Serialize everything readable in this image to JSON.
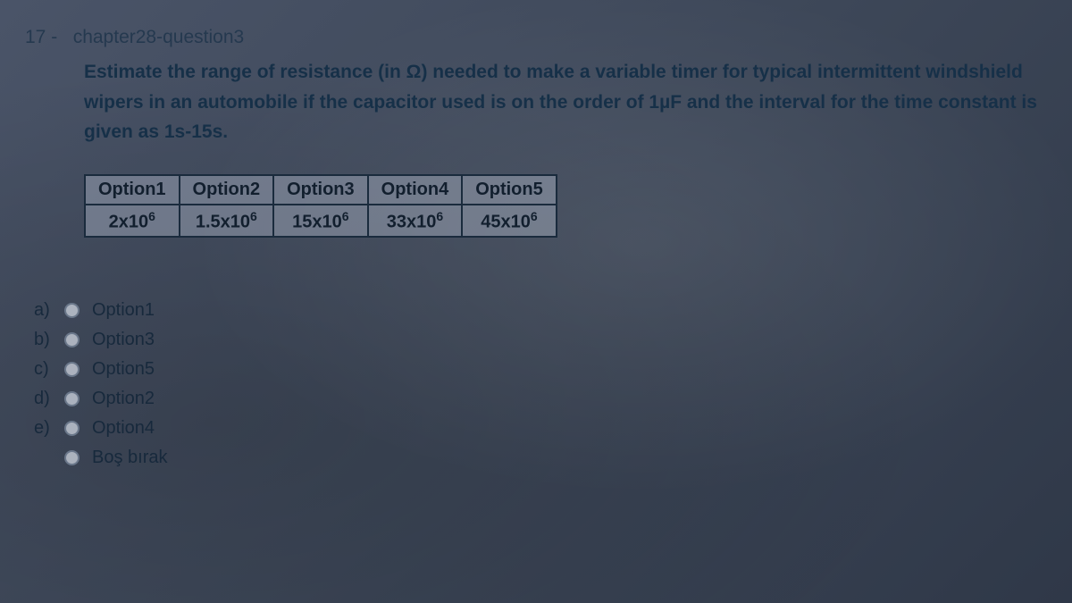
{
  "question": {
    "number": "17 -",
    "title": "chapter28-question3",
    "prompt": "Estimate the range of resistance (in Ω) needed to make a variable timer for typical intermittent windshield wipers in an automobile if the capacitor used is on the order of 1µF and the interval for the time constant is given as 1s-15s."
  },
  "table": {
    "headers": [
      "Option1",
      "Option2",
      "Option3",
      "Option4",
      "Option5"
    ],
    "values_html": [
      "2x10⁶",
      "1.5x10⁶",
      "15x10⁶",
      "33x10⁶",
      "45x10⁶"
    ]
  },
  "answers": [
    {
      "letter": "a)",
      "label": "Option1"
    },
    {
      "letter": "b)",
      "label": "Option3"
    },
    {
      "letter": "c)",
      "label": "Option5"
    },
    {
      "letter": "d)",
      "label": "Option2"
    },
    {
      "letter": "e)",
      "label": "Option4"
    },
    {
      "letter": "",
      "label": "Boş bırak"
    }
  ]
}
